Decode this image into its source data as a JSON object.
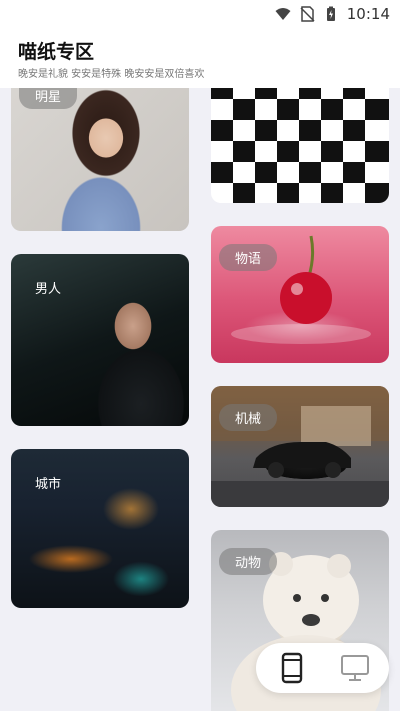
{
  "status_bar": {
    "time": "10:14"
  },
  "header": {
    "title": "喵纸专区",
    "subtitle": "晚安是礼貌 安安是特殊 晚安安是双倍喜欢"
  },
  "categories": [
    {
      "label": "明星"
    },
    {
      "label": ""
    },
    {
      "label": "男人"
    },
    {
      "label": "物语"
    },
    {
      "label": "城市"
    },
    {
      "label": "机械"
    },
    {
      "label": "动物"
    }
  ],
  "switcher": {
    "phone_icon": "phone-icon",
    "desktop_icon": "monitor-icon"
  }
}
